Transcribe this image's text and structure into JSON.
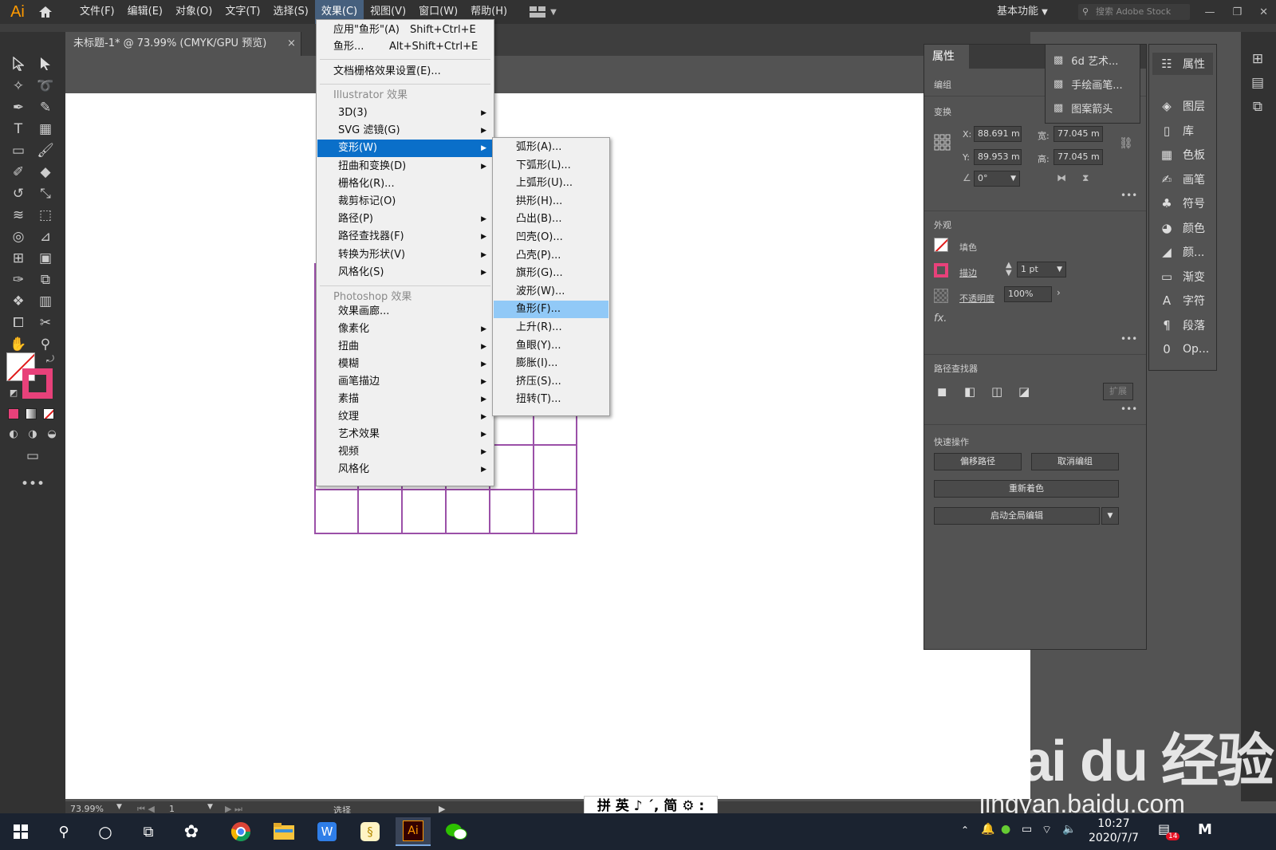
{
  "app": {
    "logo": "Ai"
  },
  "menubar": {
    "items": [
      "文件(F)",
      "编辑(E)",
      "对象(O)",
      "文字(T)",
      "选择(S)",
      "效果(C)",
      "视图(V)",
      "窗口(W)",
      "帮助(H)"
    ],
    "workspace": "基本功能",
    "search_placeholder": "搜索 Adobe Stock"
  },
  "document": {
    "tab_title": "未标题-1* @ 73.99% (CMYK/GPU 预览)",
    "close": "×"
  },
  "effect_menu": {
    "apply_last": "应用\"鱼形\"(A)",
    "apply_last_shortcut": "Shift+Ctrl+E",
    "last_effect": "鱼形...",
    "last_effect_shortcut": "Alt+Shift+Ctrl+E",
    "doc_raster": "文档栅格效果设置(E)...",
    "illustrator_header": "Illustrator 效果",
    "illustrator_items": [
      "3D(3)",
      "SVG 滤镜(G)",
      "变形(W)",
      "扭曲和变换(D)",
      "栅格化(R)...",
      "裁剪标记(O)",
      "路径(P)",
      "路径查找器(F)",
      "转换为形状(V)",
      "风格化(S)"
    ],
    "photoshop_header": "Photoshop 效果",
    "photoshop_items": [
      "效果画廊...",
      "像素化",
      "扭曲",
      "模糊",
      "画笔描边",
      "素描",
      "纹理",
      "艺术效果",
      "视频",
      "风格化"
    ]
  },
  "warp_submenu": {
    "items": [
      "弧形(A)...",
      "下弧形(L)...",
      "上弧形(U)...",
      "拱形(H)...",
      "凸出(B)...",
      "凹壳(O)...",
      "凸壳(P)...",
      "旗形(G)...",
      "波形(W)...",
      "鱼形(F)...",
      "上升(R)...",
      "鱼眼(Y)...",
      "膨胀(I)...",
      "挤压(S)...",
      "扭转(T)..."
    ],
    "highlighted": "鱼形(F)..."
  },
  "properties": {
    "tab": "属性",
    "group_label": "编组",
    "transform_label": "变换",
    "x_label": "X:",
    "x": "88.691 m",
    "y_label": "Y:",
    "y": "89.953 m",
    "w_label": "宽:",
    "w": "77.045 m",
    "h_label": "高:",
    "h": "77.045 m",
    "angle": "0°",
    "appearance_label": "外观",
    "fill_label": "填色",
    "stroke_label": "描边",
    "stroke_value": "1 pt",
    "opacity_label": "不透明度",
    "opacity_value": "100%",
    "fx": "fx.",
    "pathfinder_label": "路径查找器",
    "expand": "扩展",
    "quick_actions_label": "快速操作",
    "offset_path": "偏移路径",
    "ungroup": "取消编组",
    "recolor": "重新着色",
    "global_edit": "启动全局编辑"
  },
  "brushes": {
    "items": [
      "6d 艺术...",
      "手绘画笔...",
      "图案箭头"
    ]
  },
  "dock": {
    "items": [
      "属性",
      "图层",
      "库",
      "色板",
      "画笔",
      "符号",
      "颜色",
      "颜...",
      "渐变",
      "字符",
      "段落",
      "Op..."
    ]
  },
  "status": {
    "zoom": "73.99%",
    "page": "1",
    "tool": "选择"
  },
  "ime": {
    "text": "拼 英 ♪ ˊ, 简 ⚙ :"
  },
  "watermark": {
    "brand": "Bai du 经验",
    "url": "jingyan.baidu.com"
  },
  "taskbar": {
    "time": "10:27",
    "date": "2020/7/7",
    "badge": "14"
  },
  "colors": {
    "accent": "#0a6fc9",
    "menu_hover": "#91c9f7",
    "grid": "#9b50a8",
    "stroke_swatch": "#e8417a"
  }
}
